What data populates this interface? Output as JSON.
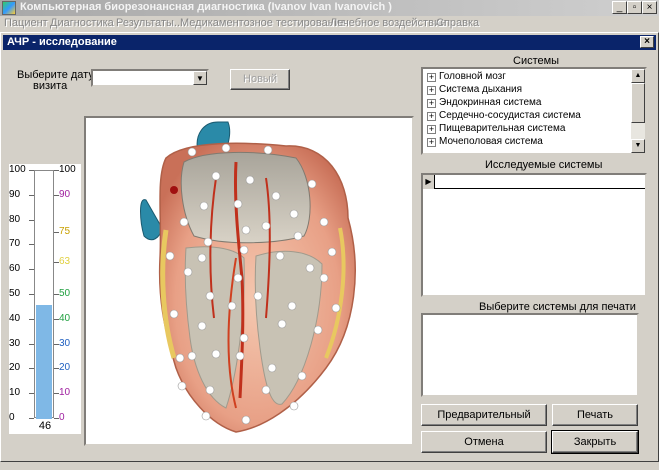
{
  "app": {
    "title": "Компьютерная биорезонансная диагностика (Ivanov Ivan Ivanovich )",
    "menu": [
      "Пациент",
      "Диагностика",
      "Результаты...",
      "Медикаментозное тестирование",
      "Лечебное воздействие",
      "Справка"
    ],
    "minimize": "_",
    "maximize": "▫",
    "close": "×"
  },
  "dialog": {
    "title": "АЧР - исследование",
    "close": "×",
    "visit_label_1": "Выберите дату",
    "visit_label_2": "визита",
    "visit_value": "",
    "new_button": "Новый",
    "systems_title": "Системы",
    "systems": [
      "Головной мозг",
      "Система дыхания",
      "Эндокринная система",
      "Сердечно-сосудистая система",
      "Пищеварительная система",
      "Мочеполовая система"
    ],
    "examined_title": "Исследуемые системы",
    "print_title": "Выберите системы для печати",
    "preview_button": "Предварительный просмотр",
    "print_button": "Печать",
    "cancel_button": "Отмена",
    "close_button": "Закрыть"
  },
  "gauge": {
    "left_scale": [
      "100",
      "90",
      "80",
      "70",
      "60",
      "50",
      "40",
      "30",
      "20",
      "10",
      "0"
    ],
    "right_scale": [
      "100",
      "90",
      "75",
      "63",
      "50",
      "40",
      "30",
      "20",
      "10",
      "0"
    ],
    "right_scale_colors": [
      "#000000",
      "#a020a0",
      "#c8a000",
      "#e0d040",
      "#20a040",
      "#20a040",
      "#2060c0",
      "#2060c0",
      "#a020a0",
      "#a020a0"
    ],
    "value": 46,
    "value_label": "46",
    "fill_color": "#7fb8e6"
  }
}
